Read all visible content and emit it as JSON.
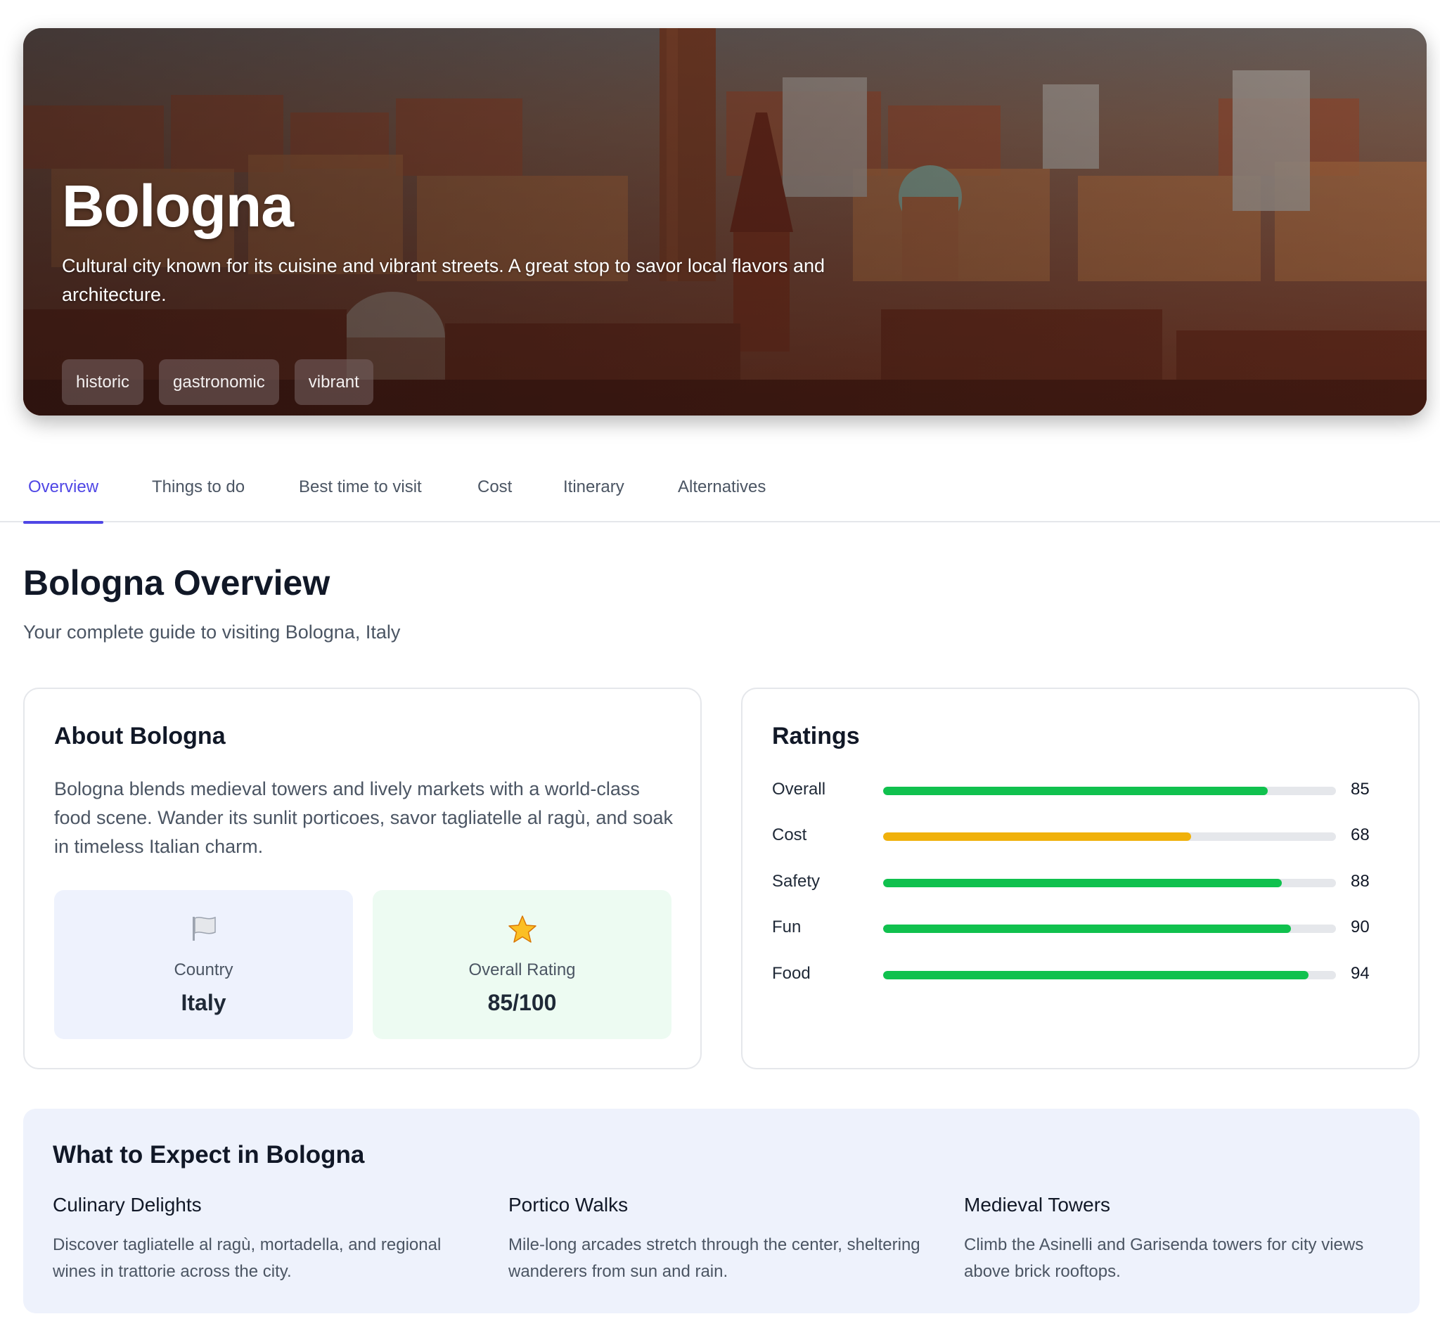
{
  "hero": {
    "title": "Bologna",
    "description": "Cultural city known for its cuisine and vibrant streets. A great stop to savor local flavors and architecture.",
    "tags": [
      "historic",
      "gastronomic",
      "vibrant"
    ]
  },
  "tabs": [
    {
      "label": "Overview",
      "active": true
    },
    {
      "label": "Things to do",
      "active": false
    },
    {
      "label": "Best time to visit",
      "active": false
    },
    {
      "label": "Cost",
      "active": false
    },
    {
      "label": "Itinerary",
      "active": false
    },
    {
      "label": "Alternatives",
      "active": false
    }
  ],
  "overview": {
    "title": "Bologna Overview",
    "subtitle": "Your complete guide to visiting Bologna, Italy"
  },
  "about": {
    "heading": "About Bologna",
    "text": "Bologna blends medieval towers and lively markets with a world-class food scene. Wander its sunlit porticoes, savor tagliatelle al ragù, and soak in timeless Italian charm.",
    "country": {
      "icon": "flag-icon",
      "label": "Country",
      "value": "Italy"
    },
    "rating": {
      "icon": "star-icon",
      "label": "Overall Rating",
      "value": "85/100"
    }
  },
  "ratings": {
    "heading": "Ratings",
    "items": [
      {
        "label": "Overall",
        "value": 85,
        "display": "85",
        "color": "#10c14e"
      },
      {
        "label": "Cost",
        "value": 68,
        "display": "68",
        "color": "#f0b10b"
      },
      {
        "label": "Safety",
        "value": 88,
        "display": "88",
        "color": "#10c14e"
      },
      {
        "label": "Fun",
        "value": 90,
        "display": "90",
        "color": "#10c14e"
      },
      {
        "label": "Food",
        "value": 94,
        "display": "94",
        "color": "#10c14e"
      }
    ]
  },
  "expect": {
    "heading": "What to Expect in Bologna",
    "items": [
      {
        "title": "Culinary Delights",
        "text": "Discover tagliatelle al ragù, mortadella, and regional wines in trattorie across the city."
      },
      {
        "title": "Portico Walks",
        "text": "Mile-long arcades stretch through the center, sheltering wanderers from sun and rain."
      },
      {
        "title": "Medieval Towers",
        "text": "Climb the Asinelli and Garisenda towers for city views above brick rooftops."
      }
    ]
  },
  "colors": {
    "accent": "#4f46e5",
    "good": "#10c14e",
    "warn": "#f0b10b"
  }
}
